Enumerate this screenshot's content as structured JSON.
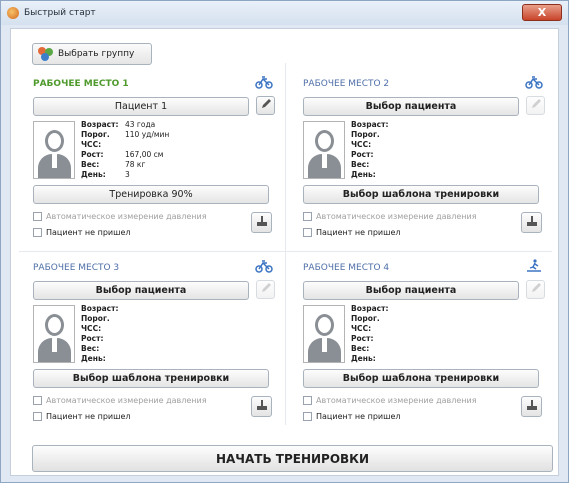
{
  "window": {
    "title": "Быстрый старт",
    "close_label": "X"
  },
  "group_button": {
    "label": "Выбрать группу"
  },
  "info_labels": {
    "age": "Возраст:",
    "hr": "Порог. ЧСС:",
    "height": "Рост:",
    "weight": "Вес:",
    "day": "День:"
  },
  "auto_bp_label": "Автоматическое измерение давления",
  "no_show_label": "Пациент не пришел",
  "workplaces": [
    {
      "title": "РАБОЧЕЕ МЕСТО 1",
      "mode_icon": "bike-icon",
      "patient_label": "Пациент 1",
      "template_label": "Тренировка 90%",
      "age": "43 года",
      "hr": "110 уд/мин",
      "height": "167,00 см",
      "weight": "78 кг",
      "day": "3"
    },
    {
      "title": "РАБОЧЕЕ МЕСТО 2",
      "mode_icon": "bike-icon",
      "patient_label": "Выбор пациента",
      "template_label": "Выбор шаблона тренировки",
      "age": "",
      "hr": "",
      "height": "",
      "weight": "",
      "day": ""
    },
    {
      "title": "РАБОЧЕЕ МЕСТО 3",
      "mode_icon": "bike-icon",
      "patient_label": "Выбор пациента",
      "template_label": "Выбор шаблона тренировки",
      "age": "",
      "hr": "",
      "height": "",
      "weight": "",
      "day": ""
    },
    {
      "title": "РАБОЧЕЕ МЕСТО 4",
      "mode_icon": "treadmill-icon",
      "patient_label": "Выбор пациента",
      "template_label": "Выбор шаблона тренировки",
      "age": "",
      "hr": "",
      "height": "",
      "weight": "",
      "day": ""
    }
  ],
  "start_button": {
    "label": "НАЧАТЬ ТРЕНИРОВКИ"
  },
  "colors": {
    "active_title": "#4f9a2d",
    "inactive_title": "#4f6fa8",
    "icon": "#3b74c2"
  }
}
